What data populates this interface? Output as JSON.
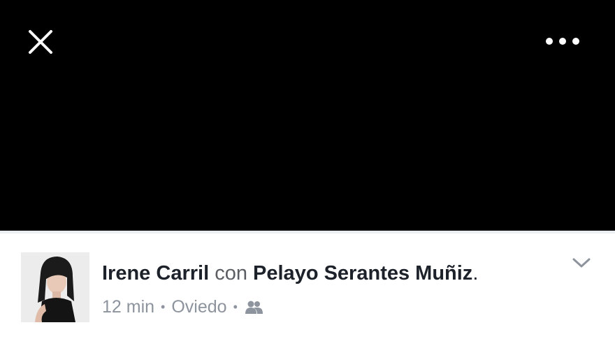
{
  "viewer": {
    "close_icon": "close-icon",
    "more_icon": "more-options-icon"
  },
  "post": {
    "author_name": "Irene Carril",
    "with_word": "con",
    "tagged_name": "Pelayo Serantes Muñiz",
    "trailing_period": ".",
    "time": "12 min",
    "separator": "•",
    "location": "Oviedo",
    "audience_icon": "friends-icon",
    "menu_icon": "chevron-down-icon"
  },
  "colors": {
    "viewer_background": "#000000",
    "name_text": "#1d2129",
    "meta_text": "#8d949e"
  }
}
